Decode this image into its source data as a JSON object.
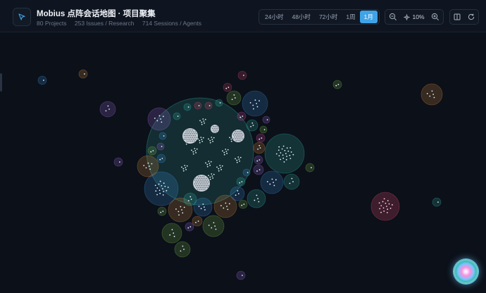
{
  "header": {
    "title": "Mobius 点阵会话地图 · 项目聚集",
    "stats": [
      "80 Projects",
      "253 Issues / Research",
      "714 Sessions / Agents"
    ]
  },
  "time_range": {
    "tabs": [
      "24小时",
      "48小时",
      "72小时",
      "1周",
      "1月"
    ],
    "active": "1月"
  },
  "zoom": {
    "level": "10%"
  },
  "icons": {
    "app": "cursor-arrow-icon",
    "zoom_out": "zoom-out-icon",
    "zoom_level": "compass-icon",
    "zoom_in": "zoom-in-icon",
    "layout": "columns-icon",
    "reset": "refresh-icon",
    "assistant": "assistant-orb-icon"
  },
  "colors": {
    "background": "#0b1019",
    "accent": "#3fa3e8",
    "cluster_teal": "#35b3a6",
    "cluster_blue": "#3b8fd6",
    "cluster_purple": "#9b6bd4",
    "cluster_orange": "#d68a3b",
    "cluster_green": "#7bb84a",
    "cluster_red": "#d8456a",
    "cluster_pink": "#d24aa0"
  }
}
